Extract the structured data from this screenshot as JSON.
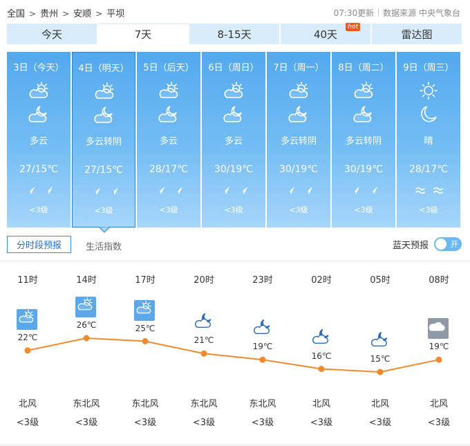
{
  "breadcrumb": [
    "全国",
    "贵州",
    "安顺",
    "平坝"
  ],
  "breadcrumb_sep": ">",
  "update_time": "07:30更新",
  "source": "数据来源 中央气象台",
  "tabs": [
    {
      "label": "今天",
      "active": false
    },
    {
      "label": "7天",
      "active": true
    },
    {
      "label": "8-15天",
      "active": false
    },
    {
      "label": "40天",
      "active": false,
      "badge": "hot"
    },
    {
      "label": "雷达图",
      "active": false
    }
  ],
  "days": [
    {
      "date": "3日（今天）",
      "day_icon": "partly-cloudy-icon",
      "night_icon": "cloudy-night-icon",
      "desc": "多云",
      "temp": "27/15℃",
      "wind_icon": "wind-arrow-icon",
      "level": "<3级",
      "selected": false
    },
    {
      "date": "4日（明天）",
      "day_icon": "partly-cloudy-icon",
      "night_icon": "cloudy-night-icon",
      "desc": "多云转阴",
      "temp": "27/15℃",
      "wind_icon": "wind-arrow-icon",
      "level": "<3级",
      "selected": true
    },
    {
      "date": "5日（后天）",
      "day_icon": "partly-cloudy-icon",
      "night_icon": "cloudy-night-icon",
      "desc": "多云",
      "temp": "28/17℃",
      "wind_icon": "wind-arrow-icon",
      "level": "<3级",
      "selected": false
    },
    {
      "date": "6日（周日）",
      "day_icon": "partly-cloudy-icon",
      "night_icon": "cloudy-night-icon",
      "desc": "多云",
      "temp": "30/19℃",
      "wind_icon": "wind-arrow-icon",
      "level": "<3级",
      "selected": false
    },
    {
      "date": "7日（周一）",
      "day_icon": "partly-cloudy-icon",
      "night_icon": "cloudy-night-icon",
      "desc": "多云转阴",
      "temp": "30/19℃",
      "wind_icon": "wind-arrow-icon",
      "level": "<3级",
      "selected": false
    },
    {
      "date": "8日（周二）",
      "day_icon": "partly-cloudy-icon",
      "night_icon": "cloudy-night-icon",
      "desc": "多云转阴",
      "temp": "30/19℃",
      "wind_icon": "wind-arrow-icon",
      "level": "<3级",
      "selected": false
    },
    {
      "date": "9日（周三）",
      "day_icon": "sun-icon",
      "night_icon": "moon-icon",
      "desc": "晴",
      "temp": "28/17℃",
      "wind_icon": "breeze-icon",
      "level": "<3级",
      "selected": false
    }
  ],
  "subtabs": {
    "hourly": "分时段预报",
    "life": "生活指数"
  },
  "bluesky": {
    "label": "蓝天预报",
    "state": "开"
  },
  "hourly": [
    {
      "time": "11时",
      "temp": 22,
      "temp_label": "22℃",
      "icon": "partly-cloudy-icon",
      "wind": "北风",
      "level": "<3级"
    },
    {
      "time": "14时",
      "temp": 26,
      "temp_label": "26℃",
      "icon": "partly-cloudy-icon",
      "wind": "东北风",
      "level": "<3级"
    },
    {
      "time": "17时",
      "temp": 25,
      "temp_label": "25℃",
      "icon": "partly-cloudy-icon",
      "wind": "东北风",
      "level": "<3级"
    },
    {
      "time": "20时",
      "temp": 21,
      "temp_label": "21℃",
      "icon": "cloudy-night-icon",
      "wind": "东北风",
      "level": "<3级"
    },
    {
      "time": "23时",
      "temp": 19,
      "temp_label": "19℃",
      "icon": "cloudy-night-icon",
      "wind": "东北风",
      "level": "<3级"
    },
    {
      "time": "02时",
      "temp": 16,
      "temp_label": "16℃",
      "icon": "cloudy-night-icon",
      "wind": "北风",
      "level": "<3级"
    },
    {
      "time": "05时",
      "temp": 15,
      "temp_label": "15℃",
      "icon": "cloudy-night-icon",
      "wind": "北风",
      "level": "<3级"
    },
    {
      "time": "08时",
      "temp": 19,
      "temp_label": "19℃",
      "icon": "overcast-icon",
      "wind": "北风",
      "level": "<3级"
    }
  ],
  "colors": {
    "accent": "#3a8ee6",
    "line": "#f08a2c",
    "card_top": "#53a9ee",
    "card_bottom": "#a7d6fa",
    "tab_bg": "#d9ecfb",
    "hot": "#f05a23"
  }
}
